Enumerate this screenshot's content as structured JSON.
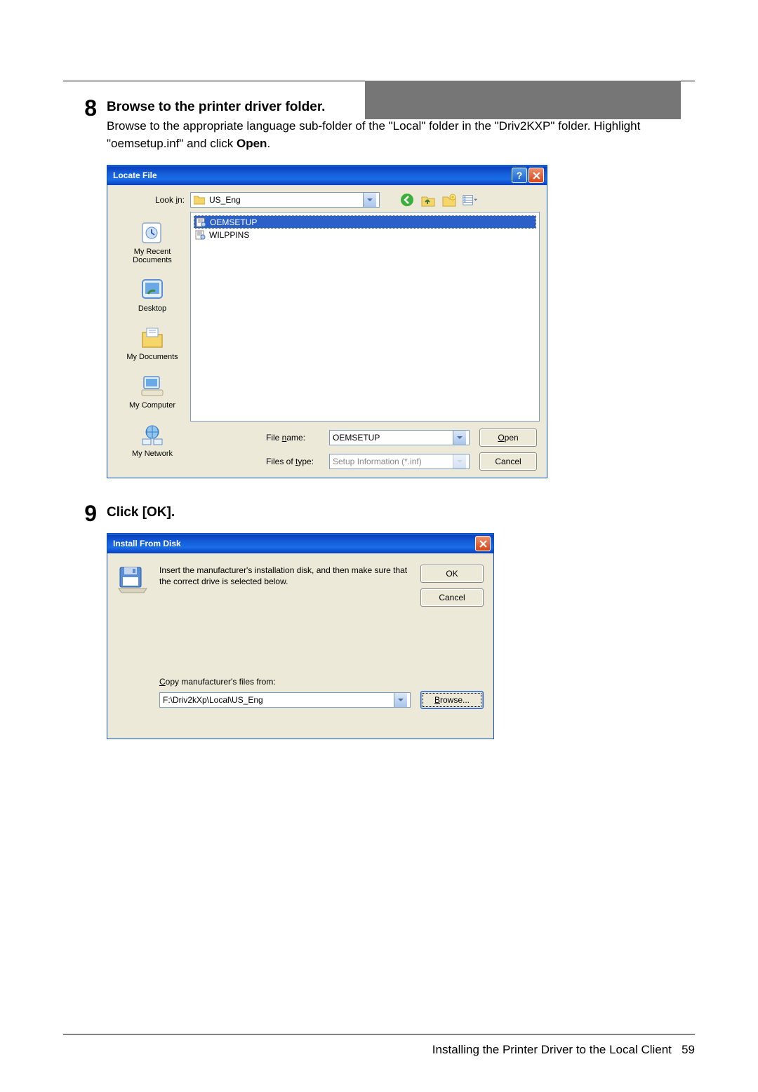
{
  "step8": {
    "number": "8",
    "title": "Browse to the printer driver folder.",
    "text_before_bold": "Browse to the appropriate language sub-folder of the \"Local\" folder in the \"Driv2KXP\" folder. Highlight \"oemsetup.inf\" and click ",
    "text_bold": "Open",
    "text_after_bold": "."
  },
  "locate_file": {
    "title": "Locate File",
    "look_in_label": "Look in:",
    "look_in_value": "US_Eng",
    "places": {
      "recent": "My Recent Documents",
      "desktop": "Desktop",
      "mydocs": "My Documents",
      "mycomputer": "My Computer",
      "mynetwork": "My Network"
    },
    "files": {
      "oemsetup": "OEMSETUP",
      "wilppins": "WILPPINS"
    },
    "file_name_label": "File name:",
    "file_name_value": "OEMSETUP",
    "file_type_label": "Files of type:",
    "file_type_value": "Setup Information (*.inf)",
    "open_button": "Open",
    "cancel_button": "Cancel",
    "open_underline": "O",
    "lookin_underline": "i",
    "filename_underline": "n",
    "filetype_underline": "t"
  },
  "step9": {
    "number": "9",
    "title": "Click [OK]."
  },
  "install_disk": {
    "title": "Install From Disk",
    "message": "Insert the manufacturer's installation disk, and then make sure that the correct drive is selected below.",
    "ok_button": "OK",
    "cancel_button": "Cancel",
    "copy_label": "Copy manufacturer's files from:",
    "copy_underline": "C",
    "path_value": "F:\\Driv2kXp\\Local\\US_Eng",
    "browse_button": "Browse...",
    "browse_underline": "B"
  },
  "footer": {
    "text": "Installing the Printer Driver to the Local Client",
    "page": "59"
  }
}
